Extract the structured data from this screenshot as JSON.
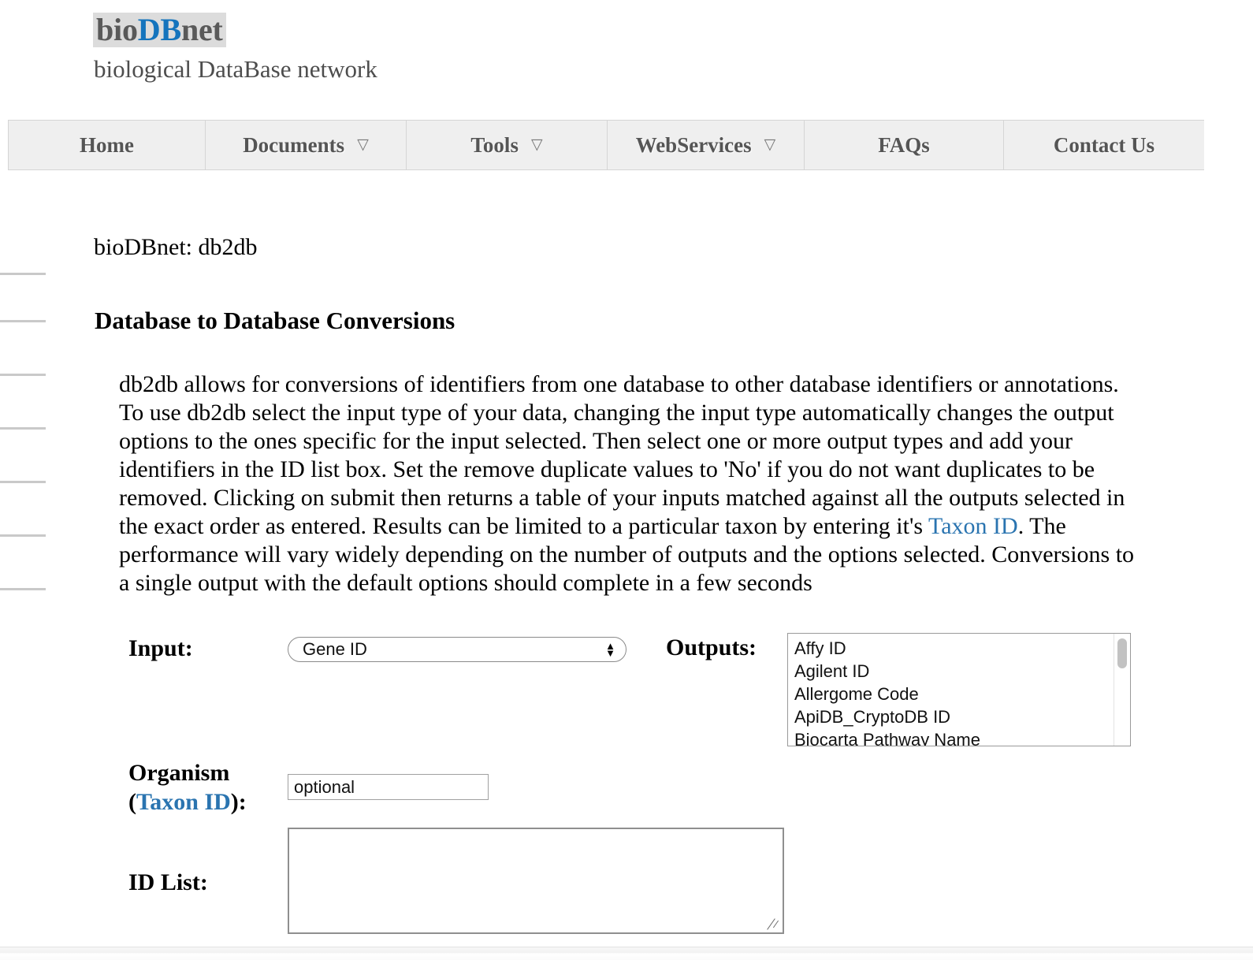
{
  "site": {
    "logo": {
      "part1": "bio",
      "part2": "DB",
      "part3": "net"
    },
    "tagline": "biological DataBase network",
    "brand_color": "#1474bd",
    "logo_gray": "#595959",
    "logo_bg": "#dcdcdc"
  },
  "nav": {
    "items": [
      {
        "label": "Home",
        "has_caret": false,
        "caret": ""
      },
      {
        "label": "Documents",
        "has_caret": true,
        "caret": "▽"
      },
      {
        "label": "Tools",
        "has_caret": true,
        "caret": "▽"
      },
      {
        "label": "WebServices",
        "has_caret": true,
        "caret": "▽"
      },
      {
        "label": "FAQs",
        "has_caret": false,
        "caret": ""
      },
      {
        "label": "Contact Us",
        "has_caret": false,
        "caret": ""
      }
    ]
  },
  "content": {
    "breadcrumb": "bioDBnet: db2db",
    "page_title": "Database to Database Conversions",
    "intro": {
      "part1": "db2db allows for conversions of identifiers from one database to other database identifiers or annotations. To use db2db select the input type of your data, changing the input type automatically changes the output options to the ones specific for the input selected. Then select one or more output types and add your identifiers in the ID list box. Set the remove duplicate values to 'No' if you do not want duplicates to be removed. Clicking on submit then returns a table of your inputs matched against all the outputs selected in the exact order as entered. Results can be limited to a particular taxon by entering it's ",
      "link_text": "Taxon ID",
      "part2": ". The performance will vary widely depending on the number of outputs and the options selected. Conversions to a single output with the default options should complete in a few seconds",
      "link_color": "#2a74b0"
    }
  },
  "form": {
    "input": {
      "label": "Input:",
      "selected_value": "Gene ID",
      "stepper_up": "▲",
      "stepper_down": "▼"
    },
    "outputs": {
      "label": "Outputs:",
      "options": [
        "Affy ID",
        "Agilent ID",
        "Allergome Code",
        "ApiDB_CryptoDB ID",
        "Biocarta Pathway Name"
      ]
    },
    "organism": {
      "label_line1": "Organism",
      "label_paren_open": "(",
      "label_link": "Taxon ID",
      "label_paren_close": "):",
      "placeholder": "optional",
      "value": ""
    },
    "id_list": {
      "label": "ID List:",
      "value": "",
      "placeholder": ""
    }
  },
  "sidebar": {
    "divider_color": "#c9c9c9",
    "divider_tops": [
      346,
      406,
      474,
      542,
      610,
      678,
      746
    ]
  }
}
